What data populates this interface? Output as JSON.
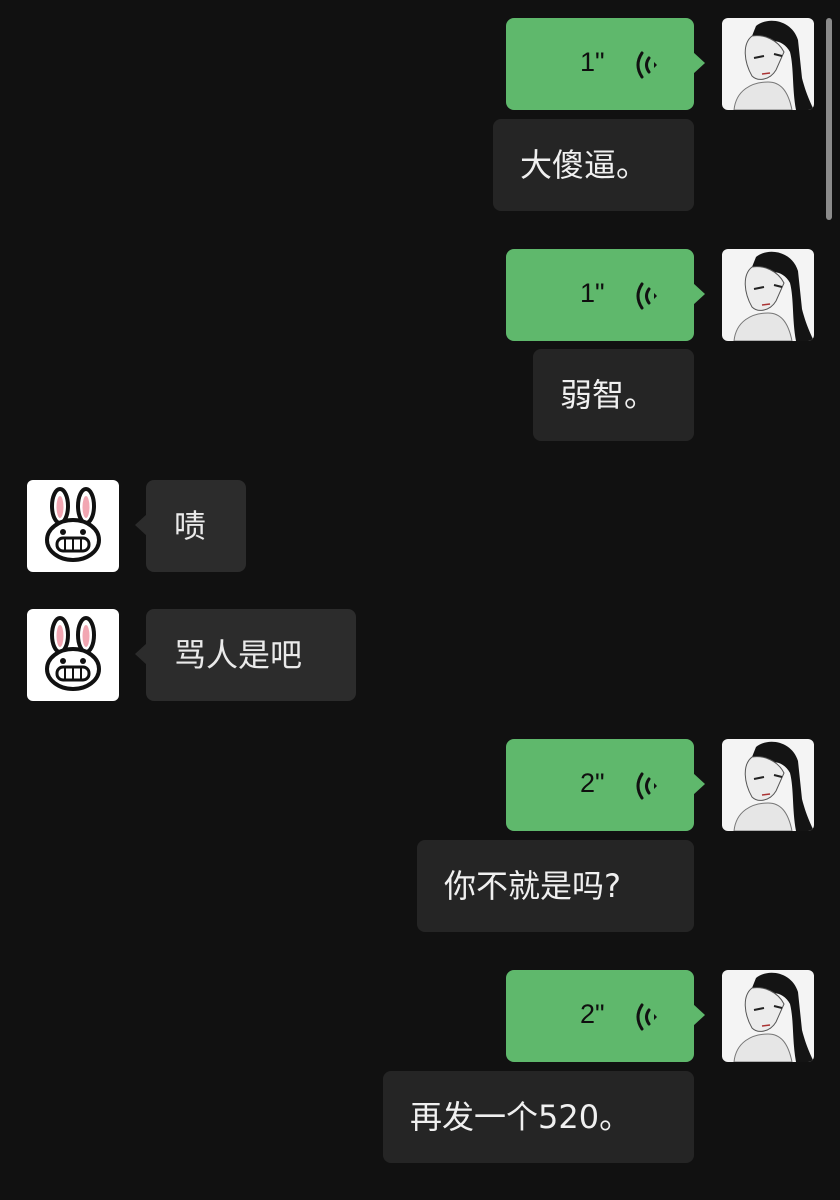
{
  "messages": [
    {
      "side": "right",
      "type": "voice",
      "duration": "1\"",
      "transcript": "大傻逼。"
    },
    {
      "side": "right",
      "type": "voice",
      "duration": "1\"",
      "transcript": "弱智。"
    },
    {
      "side": "left",
      "type": "text",
      "text": "啧"
    },
    {
      "side": "left",
      "type": "text",
      "text": "骂人是吧"
    },
    {
      "side": "right",
      "type": "voice",
      "duration": "2\"",
      "transcript": "你不就是吗?"
    },
    {
      "side": "right",
      "type": "voice",
      "duration": "2\"",
      "transcript": "再发一个520。"
    }
  ],
  "avatars": {
    "self": "woman-portrait-avatar",
    "other": "rabbit-avatar"
  },
  "colors": {
    "background": "#111111",
    "voice_bubble": "#5fb86c",
    "transcript_bubble": "#252525",
    "incoming_bubble": "#2c2c2c"
  }
}
